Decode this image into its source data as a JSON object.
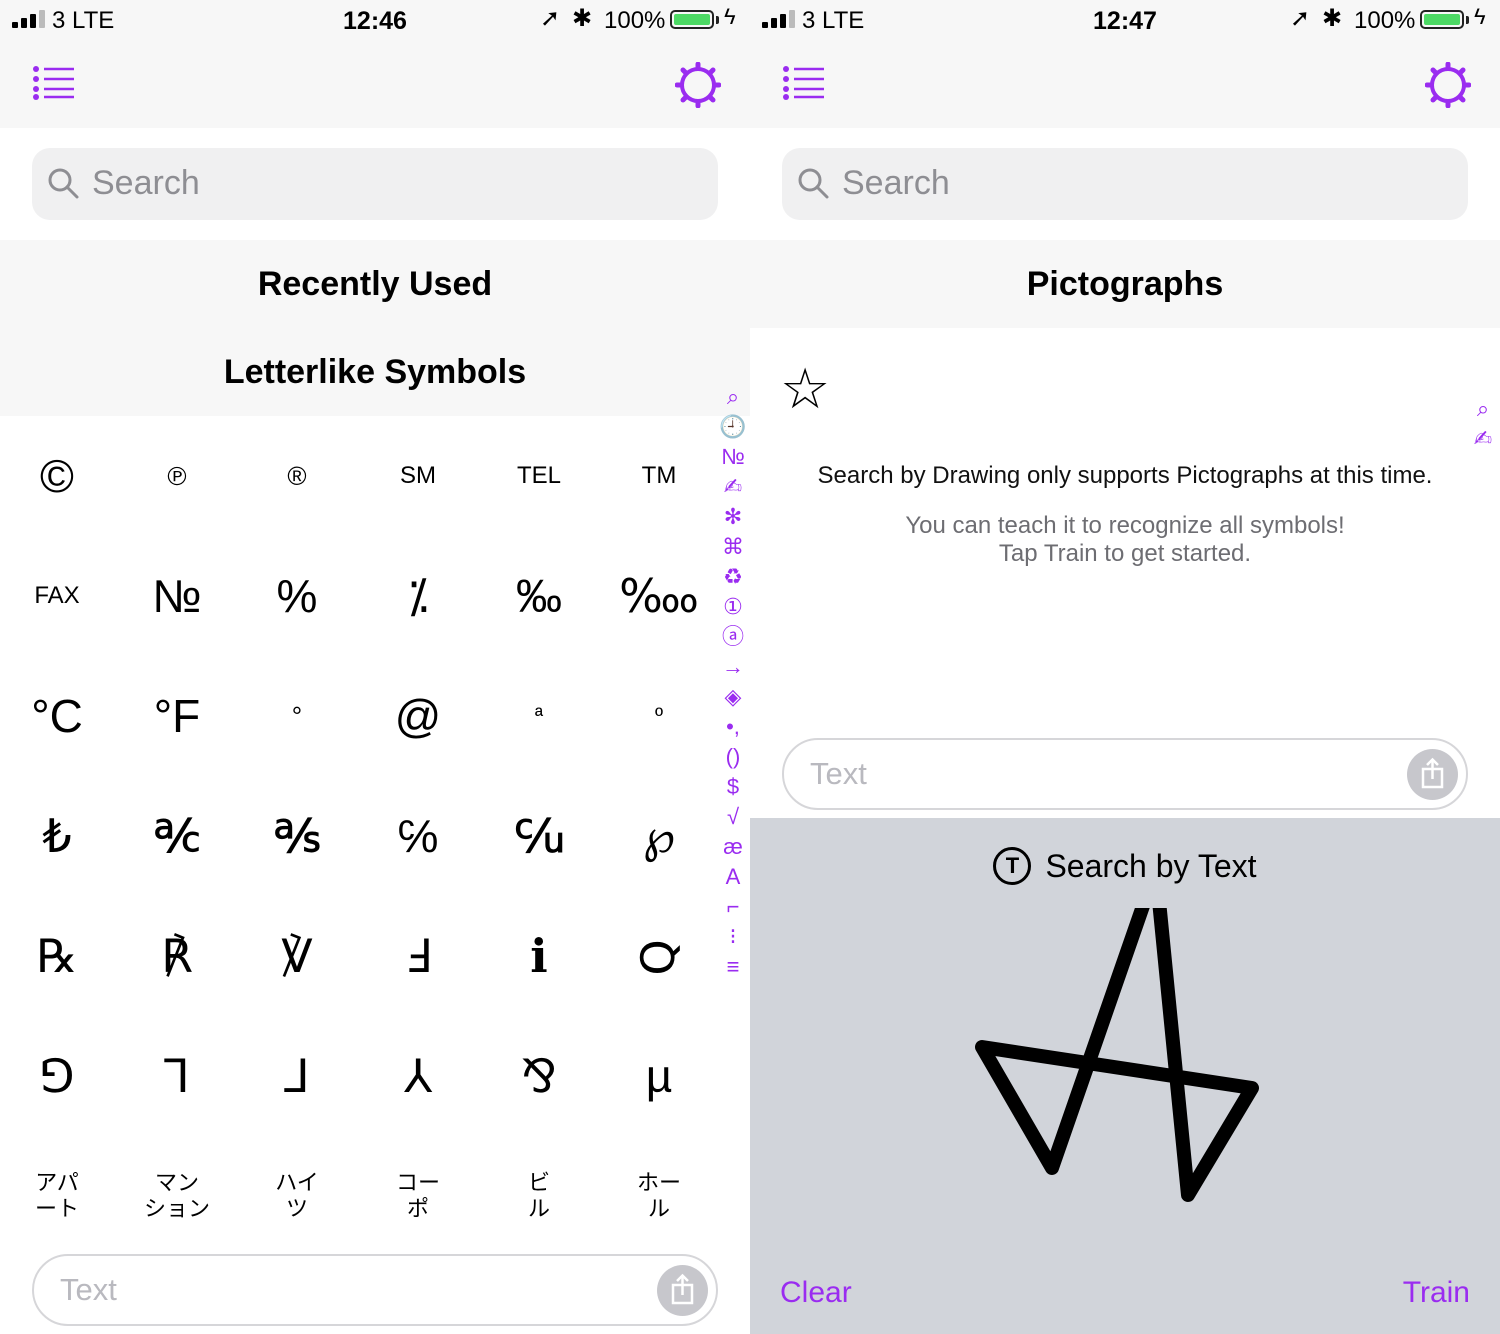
{
  "accent_color": "#9a2cf0",
  "left": {
    "status": {
      "carrier": "3   LTE",
      "time": "12:46",
      "battery": "100%"
    },
    "search_placeholder": "Search",
    "headers": [
      "Recently Used",
      "Letterlike Symbols"
    ],
    "symbols": [
      "©",
      "℗",
      "®",
      "SM",
      "TEL",
      "TM",
      "FAX",
      "№",
      "%",
      "⁒",
      "‰",
      "‱",
      "°C",
      "°F",
      "°",
      "@",
      "ª",
      "º",
      "₺",
      "℀",
      "℁",
      "℅",
      "℆",
      "℘",
      "℞",
      "℟",
      "℣",
      "Ⅎ",
      "ℹ",
      "℺",
      "⅁",
      "⅂",
      "⅃",
      "⅄",
      "⅋",
      "µ",
      "アパ\nート",
      "マン\nション",
      "ハイ\nツ",
      "コー\nポ",
      "ビ\nル",
      "ホー\nル"
    ],
    "index": [
      "⌕",
      "🕘",
      "№",
      "✍",
      "✻",
      "⌘",
      "♻",
      "①",
      "ⓐ",
      "→",
      "◈",
      "•,",
      "()",
      "$",
      "√",
      "æ",
      "A",
      "⌐",
      "⁝",
      "≡"
    ],
    "text_placeholder": "Text"
  },
  "right": {
    "status": {
      "carrier": "3   LTE",
      "time": "12:47",
      "battery": "100%"
    },
    "search_placeholder": "Search",
    "header": "Pictographs",
    "result_symbol": "☆",
    "message": "Search by Drawing only supports Pictographs at this time.",
    "hint_line1": "You can teach it to recognize all symbols!",
    "hint_line2": "Tap Train to get started.",
    "index": [
      "⌕",
      "✍"
    ],
    "text_placeholder": "Text",
    "mode_label": "Search by Text",
    "mode_icon_letter": "T",
    "clear_label": "Clear",
    "train_label": "Train"
  }
}
